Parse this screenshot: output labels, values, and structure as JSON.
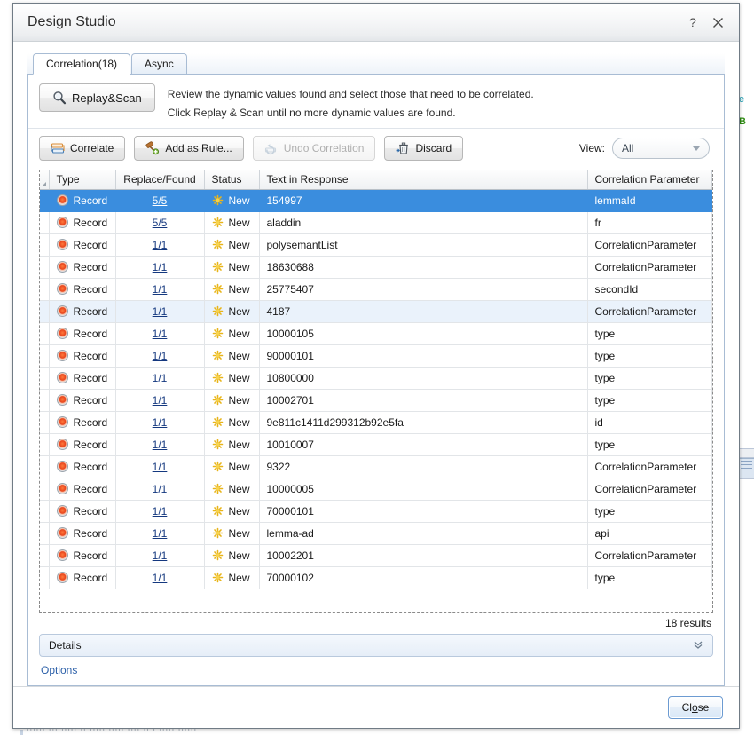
{
  "window": {
    "title": "Design Studio",
    "help_button": "?",
    "close_button": "×"
  },
  "tabs": [
    {
      "label": "Correlation(18)",
      "active": true
    },
    {
      "label": "Async",
      "active": false
    }
  ],
  "toolbar_primary": {
    "replay_scan_label": "Replay&Scan",
    "replay_scan_icon": "magnifier-icon",
    "hint_line_1": "Review the dynamic values found and select those that need to be correlated.",
    "hint_line_2": "Click Replay & Scan until no more dynamic values are found."
  },
  "toolbar_actions": [
    {
      "label": "Correlate",
      "icon": "correlate-icon",
      "enabled": true
    },
    {
      "label": "Add as Rule...",
      "icon": "gavel-icon",
      "enabled": true
    },
    {
      "label": "Undo Correlation",
      "icon": "undo-correlation-icon",
      "enabled": false
    },
    {
      "label": "Discard",
      "icon": "trash-icon",
      "enabled": true
    }
  ],
  "view_filter": {
    "label": "View:",
    "value": "All",
    "caret_icon": "chevron-down-icon"
  },
  "grid": {
    "columns": [
      {
        "key": "type",
        "label": "Type"
      },
      {
        "key": "replace",
        "label": "Replace/Found"
      },
      {
        "key": "status",
        "label": "Status"
      },
      {
        "key": "text",
        "label": "Text in Response"
      },
      {
        "key": "parameter",
        "label": "Correlation Parameter"
      }
    ],
    "rows": [
      {
        "type": "Record",
        "replace": "5/5",
        "status": "New",
        "text": "154997",
        "parameter": "lemmaId",
        "selected": true,
        "alt": false
      },
      {
        "type": "Record",
        "replace": "5/5",
        "status": "New",
        "text": "aladdin",
        "parameter": "fr",
        "selected": false,
        "alt": false
      },
      {
        "type": "Record",
        "replace": "1/1",
        "status": "New",
        "text": "polysemantList",
        "parameter": "CorrelationParameter",
        "selected": false,
        "alt": false
      },
      {
        "type": "Record",
        "replace": "1/1",
        "status": "New",
        "text": "18630688",
        "parameter": "CorrelationParameter",
        "selected": false,
        "alt": false
      },
      {
        "type": "Record",
        "replace": "1/1",
        "status": "New",
        "text": "25775407",
        "parameter": "secondId",
        "selected": false,
        "alt": false
      },
      {
        "type": "Record",
        "replace": "1/1",
        "status": "New",
        "text": "4187",
        "parameter": "CorrelationParameter",
        "selected": false,
        "alt": true
      },
      {
        "type": "Record",
        "replace": "1/1",
        "status": "New",
        "text": "10000105",
        "parameter": "type",
        "selected": false,
        "alt": false
      },
      {
        "type": "Record",
        "replace": "1/1",
        "status": "New",
        "text": "90000101",
        "parameter": "type",
        "selected": false,
        "alt": false
      },
      {
        "type": "Record",
        "replace": "1/1",
        "status": "New",
        "text": "10800000",
        "parameter": "type",
        "selected": false,
        "alt": false
      },
      {
        "type": "Record",
        "replace": "1/1",
        "status": "New",
        "text": "10002701",
        "parameter": "type",
        "selected": false,
        "alt": false
      },
      {
        "type": "Record",
        "replace": "1/1",
        "status": "New",
        "text": "9e811c1411d299312b92e5fa",
        "parameter": "id",
        "selected": false,
        "alt": false
      },
      {
        "type": "Record",
        "replace": "1/1",
        "status": "New",
        "text": "10010007",
        "parameter": "type",
        "selected": false,
        "alt": false
      },
      {
        "type": "Record",
        "replace": "1/1",
        "status": "New",
        "text": "9322",
        "parameter": "CorrelationParameter",
        "selected": false,
        "alt": false
      },
      {
        "type": "Record",
        "replace": "1/1",
        "status": "New",
        "text": "10000005",
        "parameter": "CorrelationParameter",
        "selected": false,
        "alt": false
      },
      {
        "type": "Record",
        "replace": "1/1",
        "status": "New",
        "text": "70000101",
        "parameter": "type",
        "selected": false,
        "alt": false
      },
      {
        "type": "Record",
        "replace": "1/1",
        "status": "New",
        "text": "lemma-ad",
        "parameter": "api",
        "selected": false,
        "alt": false
      },
      {
        "type": "Record",
        "replace": "1/1",
        "status": "New",
        "text": "10002201",
        "parameter": "CorrelationParameter",
        "selected": false,
        "alt": false
      },
      {
        "type": "Record",
        "replace": "1/1",
        "status": "New",
        "text": "70000102",
        "parameter": "type",
        "selected": false,
        "alt": false
      }
    ]
  },
  "results_count": "18 results",
  "details_panel": {
    "label": "Details",
    "collapse_icon": "chevron-double-down-icon"
  },
  "options_link": "Options",
  "footer": {
    "close_label_before": "Cl",
    "close_accel": "o",
    "close_label_after": "se"
  },
  "background": {
    "fragment_cyan": "e",
    "fragment_green": "B",
    "bottom_text": "tttttt  ttt  ttttt  tt  ttttt ttttt  tttt tt  t   ttttt  tttttt"
  },
  "colors": {
    "selection_blue": "#3a8dde",
    "alt_row_blue": "#eaf2fb",
    "link_blue": "#14387f",
    "options_link": "#2b5fa8",
    "record_orange": "#e8441c",
    "status_yellow": "#f0c419",
    "tab_border": "#a8bcd4"
  }
}
